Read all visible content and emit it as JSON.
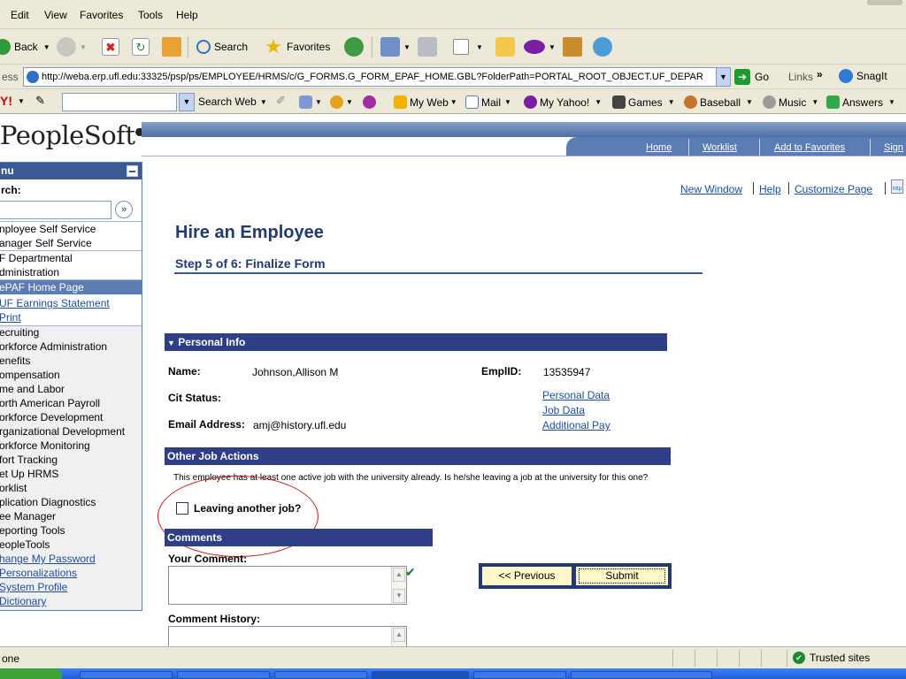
{
  "browser": {
    "menu": [
      "Edit",
      "View",
      "Favorites",
      "Tools",
      "Help"
    ],
    "toolbar": {
      "back": "Back",
      "search": "Search",
      "favorites": "Favorites"
    },
    "address": {
      "label": "ess",
      "url": "http://weba.erp.ufl.edu:33325/psp/ps/EMPLOYEE/HRMS/c/G_FORMS.G_FORM_EPAF_HOME.GBL?FolderPath=PORTAL_ROOT_OBJECT.UF_DEPAR",
      "go": "Go",
      "links": "Links",
      "snagit": "SnagIt"
    },
    "yahoo": {
      "search_web": "Search Web",
      "my_web": "My Web",
      "mail": "Mail",
      "my_yahoo": "My Yahoo!",
      "games": "Games",
      "baseball": "Baseball",
      "music": "Music",
      "answers": "Answers"
    },
    "status": {
      "text": "one",
      "zone": "Trusted sites"
    }
  },
  "header": {
    "logo": "PeopleSoft",
    "nav": [
      "Home",
      "Worklist",
      "Add to Favorites",
      "Sign"
    ]
  },
  "menu": {
    "title": "nu",
    "search_label": "rch:",
    "group1": [
      "nployee Self Service",
      "anager Self Service"
    ],
    "group2": [
      "F Departmental",
      "dministration"
    ],
    "group3": [
      {
        "label": "ePAF Home Page",
        "state": "selected"
      },
      {
        "label": "UF Earnings Statement",
        "state": "link"
      },
      {
        "label": "Print",
        "state": "link"
      }
    ],
    "group4": [
      "ecruiting",
      "orkforce Administration",
      "enefits",
      "ompensation",
      "me and Labor",
      "orth American Payroll",
      "orkforce Development",
      "rganizational Development",
      "orkforce Monitoring",
      "fort Tracking",
      "et Up HRMS",
      "orklist",
      "plication Diagnostics",
      "ee Manager",
      "eporting Tools",
      "eopleTools"
    ],
    "group5": [
      "hange My Password",
      "Personalizations",
      "System Profile",
      "Dictionary"
    ]
  },
  "toplinks": {
    "new_window": "New Window",
    "help": "Help",
    "customize": "Customize Page"
  },
  "form": {
    "title": "Hire an Employee",
    "step": "Step 5 of 6: Finalize Form",
    "personal_info": {
      "section": "Personal Info",
      "name_label": "Name:",
      "name_value": "Johnson,Allison M",
      "emplid_label": "EmplID:",
      "emplid_value": "13535947",
      "cit_label": "Cit Status:",
      "email_label": "Email Address:",
      "email_value": "amj@history.ufl.edu",
      "links": [
        "Personal Data",
        "Job Data",
        "Additional Pay"
      ]
    },
    "other_jobs": {
      "section": "Other Job Actions",
      "text": "This employee has at least one active job with the university already. Is he/she leaving a job at the university for this one?",
      "checkbox_label": "Leaving another job?",
      "checked": false
    },
    "comments": {
      "section": "Comments",
      "your_comment": "Your Comment:",
      "history": "Comment History:"
    },
    "buttons": {
      "previous": "<< Previous",
      "submit": "Submit"
    }
  },
  "colors": {
    "section_bar": "#2f3f86",
    "title": "#213a72",
    "menu_selected": "#5b7db4",
    "annotation": "#d11a1a",
    "button_fill": "#fff8c8"
  }
}
